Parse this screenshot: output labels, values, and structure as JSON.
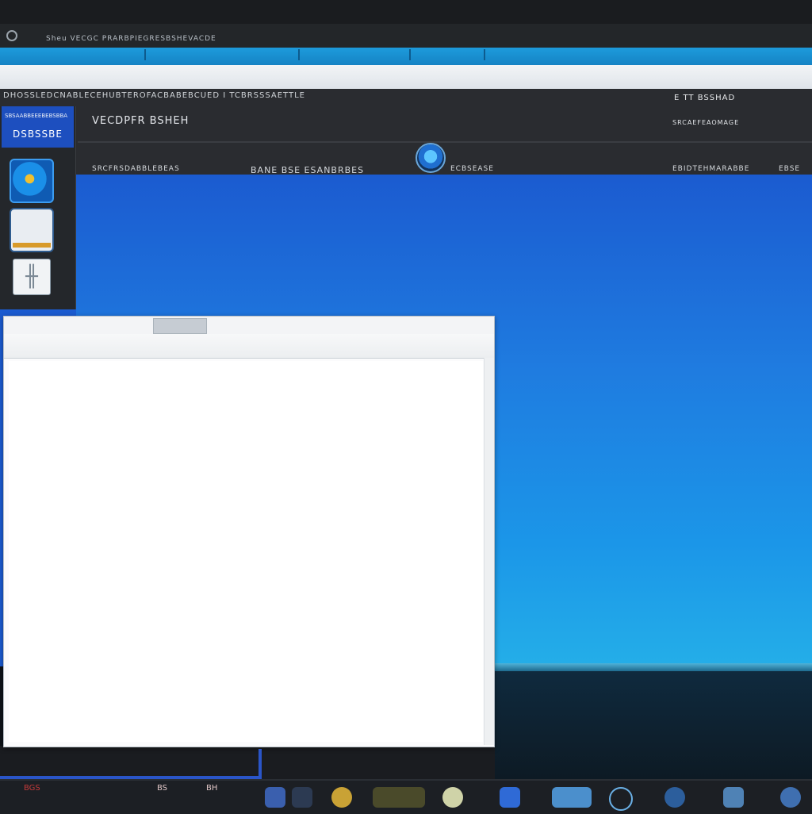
{
  "window_title": "Sheu  VECGC PRARBPIEGRESBSHEVACDE",
  "ribbon": {
    "menu_text": "DHOSSLEDCNABLECEHUBTEROFACBABEBCUED  I TCBRSSSAETTLE",
    "right_label_1": "E TT BSSHAD",
    "title": "VECDPFR BSHEH",
    "right_label_2": "SRCAEFEAOMAGE",
    "footer_left": "SRCFRSDABBLEBEAS",
    "footer_mid": "BANE  BSE  ESANBRBES",
    "footer_mid2": "ECBSEASE",
    "footer_right": "EBIDTEHMARABBE",
    "footer_far_right": "EBSE"
  },
  "left_panel": {
    "header_small": "SBSAABBEEEBEBSBBA",
    "header_big": "DSBSSBE",
    "tile3_glyph": "╫"
  },
  "taskbar": {
    "text_1": "BGS",
    "text_2": "BS",
    "text_3": "BH"
  },
  "colors": {
    "desktop_blue": "#1f7ce0",
    "ribbon_dark": "#2a2c30",
    "accent_blue": "#1b5bd0"
  }
}
